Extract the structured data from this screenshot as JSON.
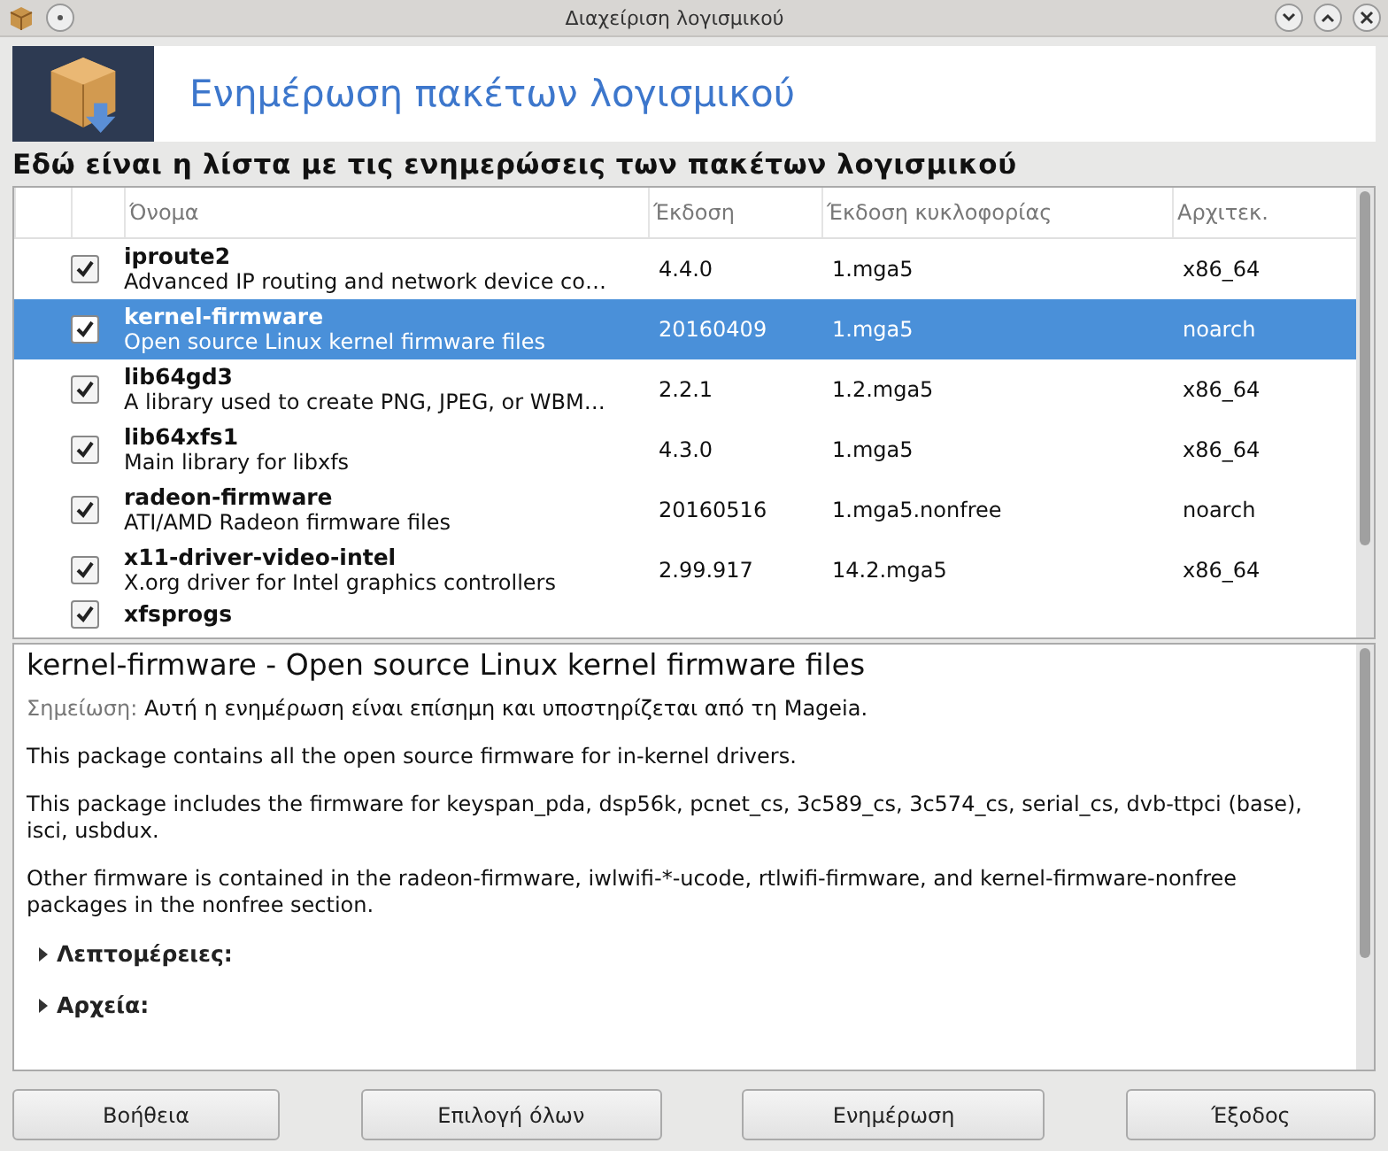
{
  "window": {
    "title": "Διαχείριση λογισμικού"
  },
  "banner": {
    "title": "Ενημέρωση πακέτων λογισμικού"
  },
  "subtitle": "Εδώ είναι η λίστα με τις ενημερώσεις των πακέτων λογισμικού",
  "table": {
    "columns": [
      "Όνομα",
      "Έκδοση",
      "Έκδοση κυκλοφορίας",
      "Αρχιτεκ."
    ],
    "rows": [
      {
        "name": "iproute2",
        "summary": "Advanced IP routing and network device co…",
        "version": "4.4.0",
        "release": "1.mga5",
        "arch": "x86_64",
        "checked": true,
        "selected": false
      },
      {
        "name": "kernel-firmware",
        "summary": "Open source Linux kernel firmware files",
        "version": "20160409",
        "release": "1.mga5",
        "arch": "noarch",
        "checked": true,
        "selected": true
      },
      {
        "name": "lib64gd3",
        "summary": "A library used to create PNG, JPEG, or WBM…",
        "version": "2.2.1",
        "release": "1.2.mga5",
        "arch": "x86_64",
        "checked": true,
        "selected": false
      },
      {
        "name": "lib64xfs1",
        "summary": "Main library for libxfs",
        "version": "4.3.0",
        "release": "1.mga5",
        "arch": "x86_64",
        "checked": true,
        "selected": false
      },
      {
        "name": "radeon-firmware",
        "summary": "ATI/AMD Radeon firmware files",
        "version": "20160516",
        "release": "1.mga5.nonfree",
        "arch": "noarch",
        "checked": true,
        "selected": false
      },
      {
        "name": "x11-driver-video-intel",
        "summary": "X.org driver for Intel graphics controllers",
        "version": "2.99.917",
        "release": "14.2.mga5",
        "arch": "x86_64",
        "checked": true,
        "selected": false
      },
      {
        "name": "xfsprogs",
        "checked": true,
        "selected": false
      }
    ]
  },
  "details": {
    "heading": "kernel-firmware - Open source Linux kernel firmware files",
    "note_label": "Σημείωση:",
    "note": "Αυτή η ενημέρωση είναι επίσημη και υποστηρίζεται από τη Mageia.",
    "paragraphs": [
      "This package contains all the open source firmware for in-kernel drivers.",
      "This package includes the firmware for keyspan_pda, dsp56k, pcnet_cs, 3c589_cs, 3c574_cs, serial_cs, dvb-ttpci (base), isci, usbdux.",
      "Other firmware is contained in the radeon-firmware, iwlwifi-*-ucode, rtlwifi-firmware, and kernel-firmware-nonfree packages in the nonfree section."
    ],
    "sections": [
      {
        "label": "Λεπτομέρειες:",
        "expanded": false
      },
      {
        "label": "Αρχεία:",
        "expanded": false
      }
    ]
  },
  "buttons": [
    "Βοήθεια",
    "Επιλογή όλων",
    "Ενημέρωση",
    "Έξοδος"
  ]
}
